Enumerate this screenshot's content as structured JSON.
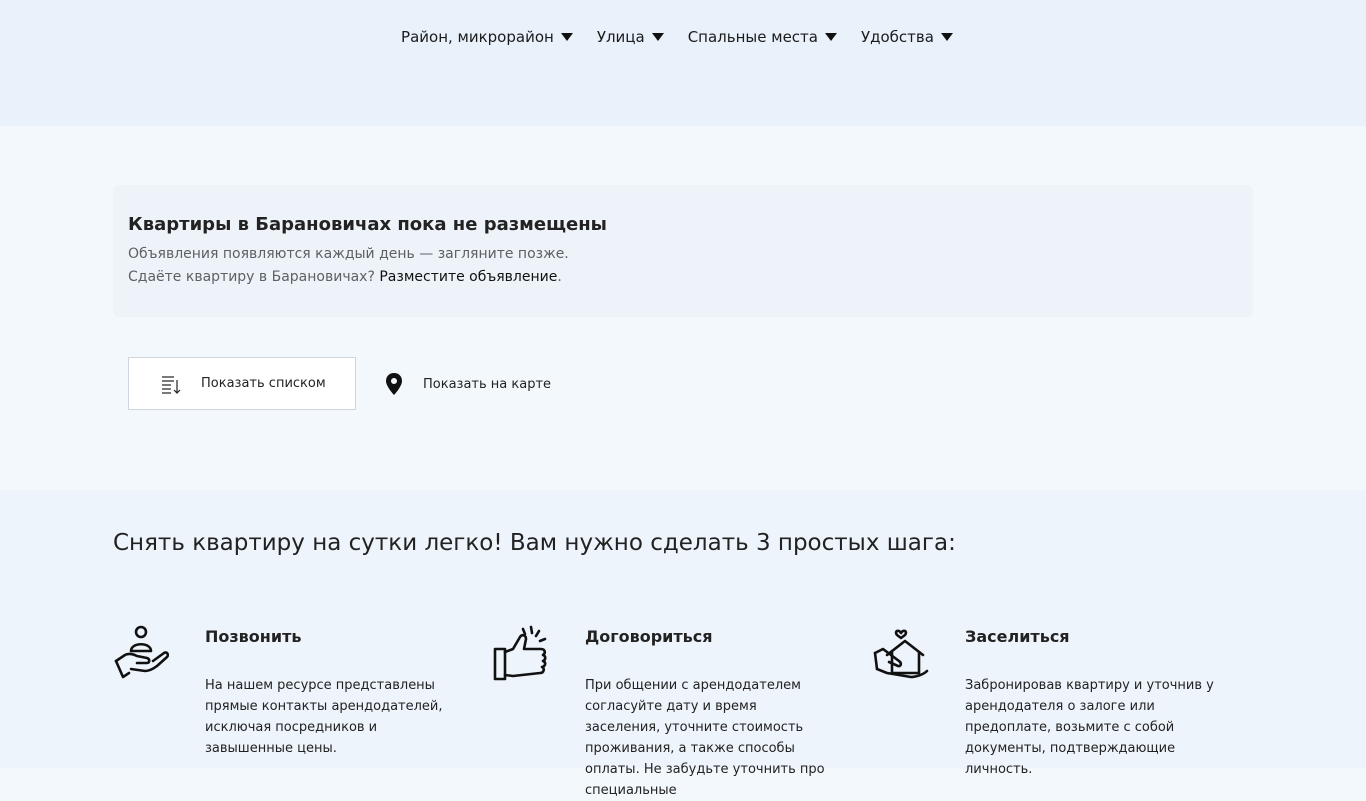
{
  "filters": [
    {
      "label": "Район, микрорайон"
    },
    {
      "label": "Улица"
    },
    {
      "label": "Спальные места"
    },
    {
      "label": "Удобства"
    }
  ],
  "notice": {
    "title": "Квартиры в Барановичах пока не размещены",
    "line1": "Объявления появляются каждый день — загляните позже.",
    "line2_prefix": "Сдаёте квартиру в Барановичах? ",
    "line2_link": "Разместите объявление",
    "line2_suffix": "."
  },
  "view": {
    "list_label": "Показать списком",
    "map_label": "Показать на карте"
  },
  "steps": {
    "heading": "Снять квартиру на сутки легко! Вам нужно сделать 3 простых шага:",
    "items": [
      {
        "icon": "hand-person-icon",
        "title": "Позвонить",
        "text": "На нашем ресурсе представлены прямые контакты арендодателей, исключая посредников и завышенные цены."
      },
      {
        "icon": "thumbs-up-icon",
        "title": "Договориться",
        "text": "При общении с арендодателем согласуйте дату и время заселения, уточните стоимость проживания, а также способы оплаты. Не забудьте уточнить про специальные"
      },
      {
        "icon": "hand-house-icon",
        "title": "Заселиться",
        "text": "Забронировав квартиру и уточнив у арендодателя о залоге или предоплате, возьмите с собой документы, подтверждающие личность."
      }
    ]
  }
}
